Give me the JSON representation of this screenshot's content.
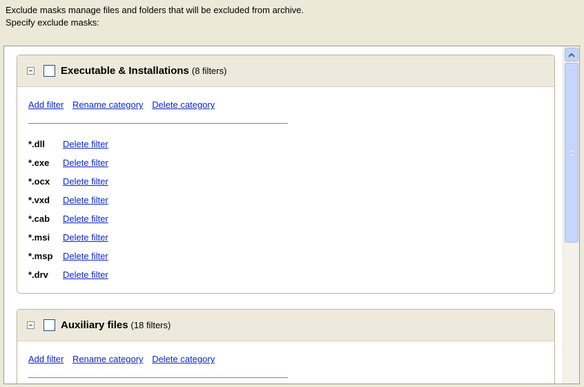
{
  "description": {
    "line1": "Exclude masks manage files and folders that will be excluded from archive.",
    "line2": "Specify exclude masks:"
  },
  "categories": [
    {
      "title": "Executable & Installations",
      "count": "(8 filters)",
      "actions": {
        "add": "Add filter",
        "rename": "Rename category",
        "delete": "Delete category"
      },
      "filters": [
        {
          "mask": "*.dll",
          "delete": "Delete filter"
        },
        {
          "mask": "*.exe",
          "delete": "Delete filter"
        },
        {
          "mask": "*.ocx",
          "delete": "Delete filter"
        },
        {
          "mask": "*.vxd",
          "delete": "Delete filter"
        },
        {
          "mask": "*.cab",
          "delete": "Delete filter"
        },
        {
          "mask": "*.msi",
          "delete": "Delete filter"
        },
        {
          "mask": "*.msp",
          "delete": "Delete filter"
        },
        {
          "mask": "*.drv",
          "delete": "Delete filter"
        }
      ]
    },
    {
      "title": "Auxiliary files",
      "count": "(18 filters)",
      "actions": {
        "add": "Add filter",
        "rename": "Rename category",
        "delete": "Delete category"
      }
    }
  ],
  "icons": {
    "collapse": "collapse-icon",
    "scroll_up": "chevron-up-icon"
  }
}
